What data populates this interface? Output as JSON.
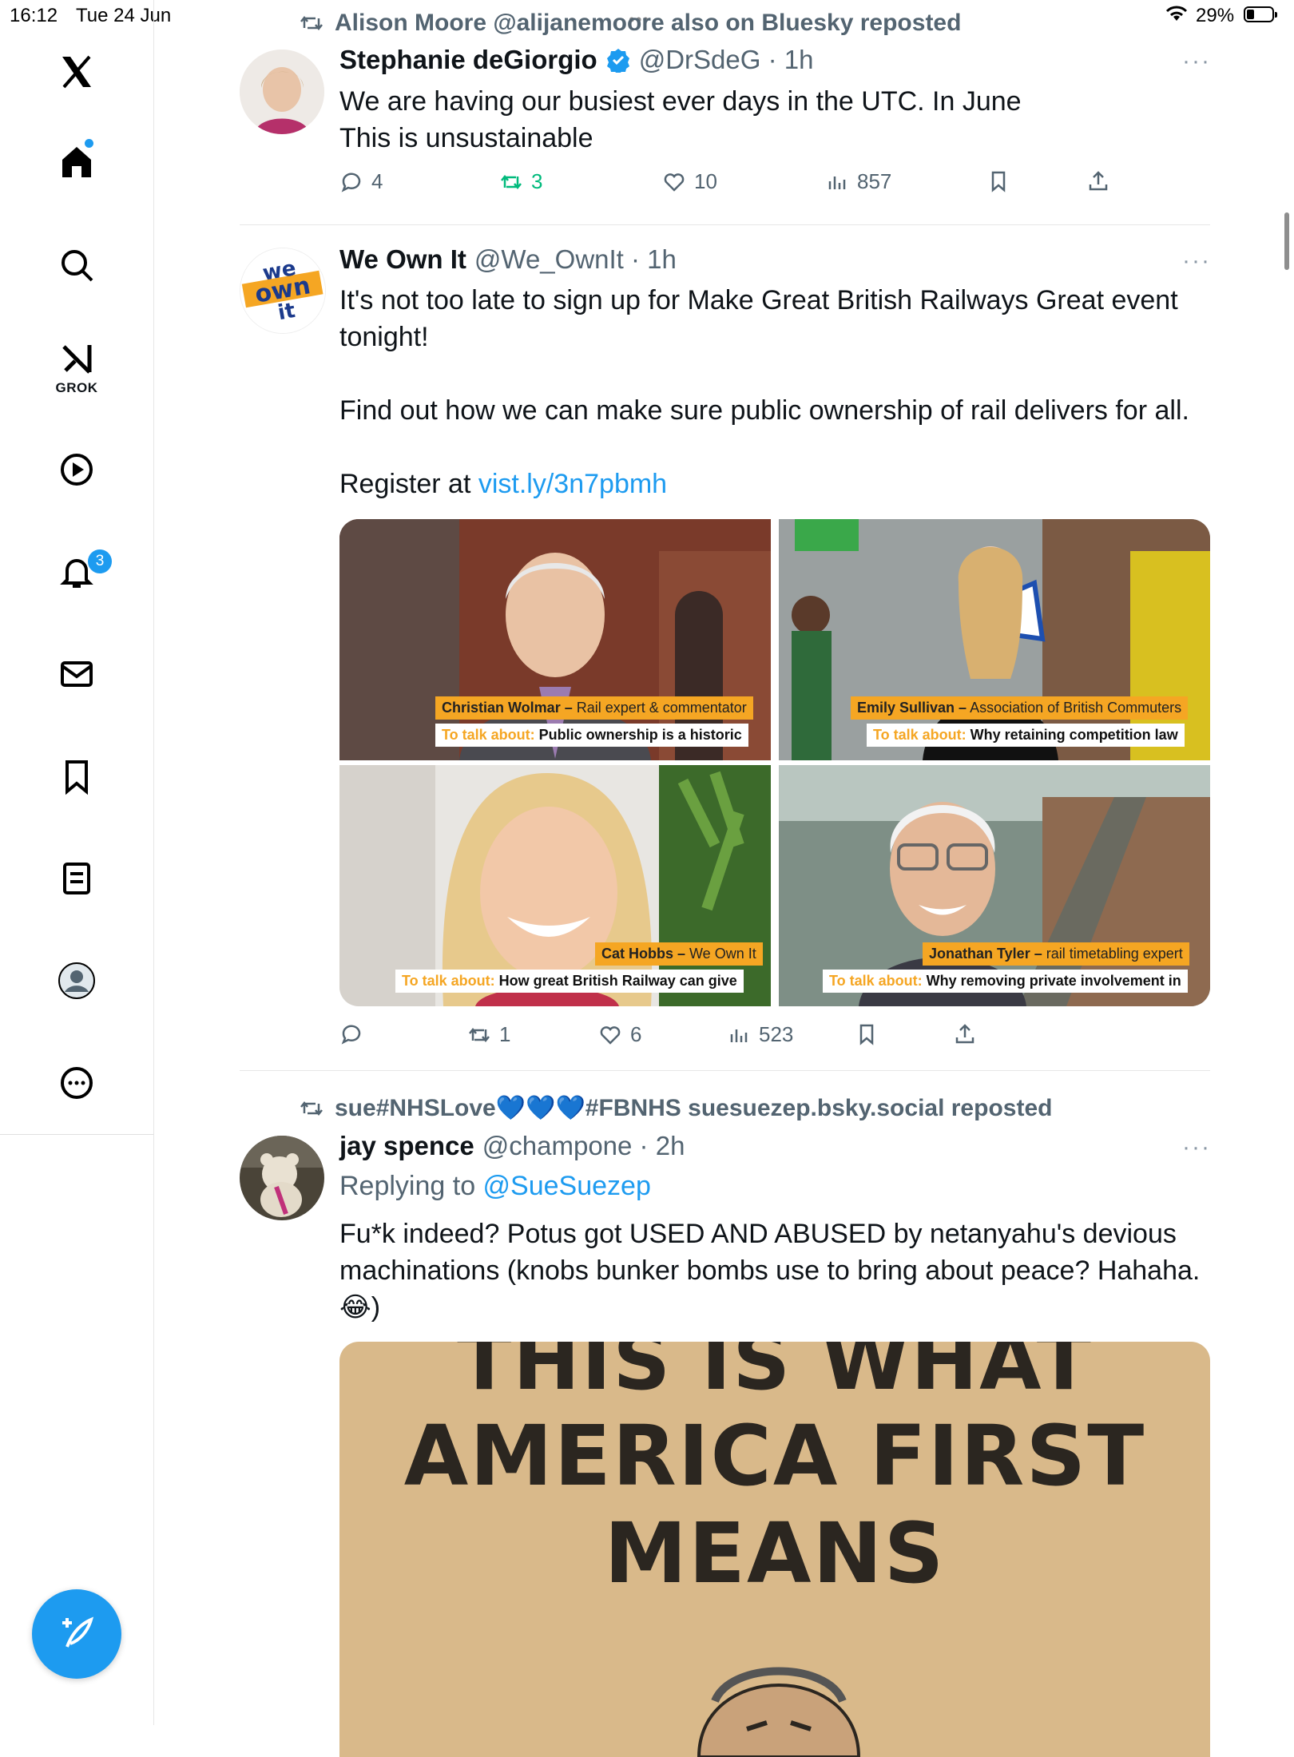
{
  "status_bar": {
    "time": "16:12",
    "date": "Tue 24 Jun",
    "battery": "29%",
    "battery_level": 0.29
  },
  "sidebar": {
    "grok_label": "GROK",
    "notifications_count": "3",
    "items": [
      "home-icon",
      "search-icon",
      "grok-icon",
      "video-icon",
      "notifications-icon",
      "messages-icon",
      "bookmarks-icon",
      "lists-icon",
      "profile-icon",
      "more-icon"
    ]
  },
  "feed": {
    "post1": {
      "repost_line": "Alison Moore @alijanemoore also on Bluesky reposted",
      "name": "Stephanie deGiorgio",
      "handle_time": "@DrSdeG · 1h",
      "verified": true,
      "text": "We are having our busiest ever days in the UTC. In June\nThis is unsustainable",
      "replies": "4",
      "reposts": "3",
      "likes": "10",
      "views": "857"
    },
    "post2": {
      "name": "We Own It",
      "handle_time": "@We_OwnIt · 1h",
      "avatar_text": [
        "we",
        "own",
        "it"
      ],
      "text": "It's not too late to sign up for Make Great British Railways Great event tonight!\n\nFind out how we can make sure public ownership of rail delivers for all.\n\nRegister at ",
      "link": "vist.ly/3n7pbmh",
      "replies": "",
      "reposts": "1",
      "likes": "6",
      "views": "523",
      "images": [
        {
          "name_cap": "Christian Wolmar –",
          "role_cap": " Rail expert & commentator",
          "talk_label": "To talk about:",
          "talk": " Public ownership is a historic"
        },
        {
          "name_cap": "Emily Sullivan –",
          "role_cap": " Association of British Commuters",
          "talk_label": "To talk about:",
          "talk": " Why retaining competition law"
        },
        {
          "name_cap": "Cat Hobbs –",
          "role_cap": " We Own It",
          "talk_label": "To talk about:",
          "talk": " How great British Railway can give"
        },
        {
          "name_cap": "Jonathan Tyler –",
          "role_cap": " rail timetabling expert",
          "talk_label": "To talk about:",
          "talk": " Why removing private involvement in"
        }
      ]
    },
    "post3": {
      "repost_line": "sue#NHSLove💙💙💙#FBNHS suesuezep.bsky.social reposted",
      "name": "jay spence",
      "handle_time": "@champone · 2h",
      "replying_label": "Replying to ",
      "replying_to": "@SueSuezep",
      "text": "Fu*k indeed? Potus got USED AND ABUSED by netanyahu's devious machinations (knobs bunker bombs use to bring about peace? Hahaha. 😂)",
      "poster_lines": [
        "THIS IS WHAT",
        "AMERICA FIRST",
        "MEANS"
      ]
    }
  },
  "colors": {
    "accent": "#1d9bf0",
    "repost_green": "#00ba7c",
    "muted": "#536471",
    "caption_orange": "#f5a623"
  }
}
